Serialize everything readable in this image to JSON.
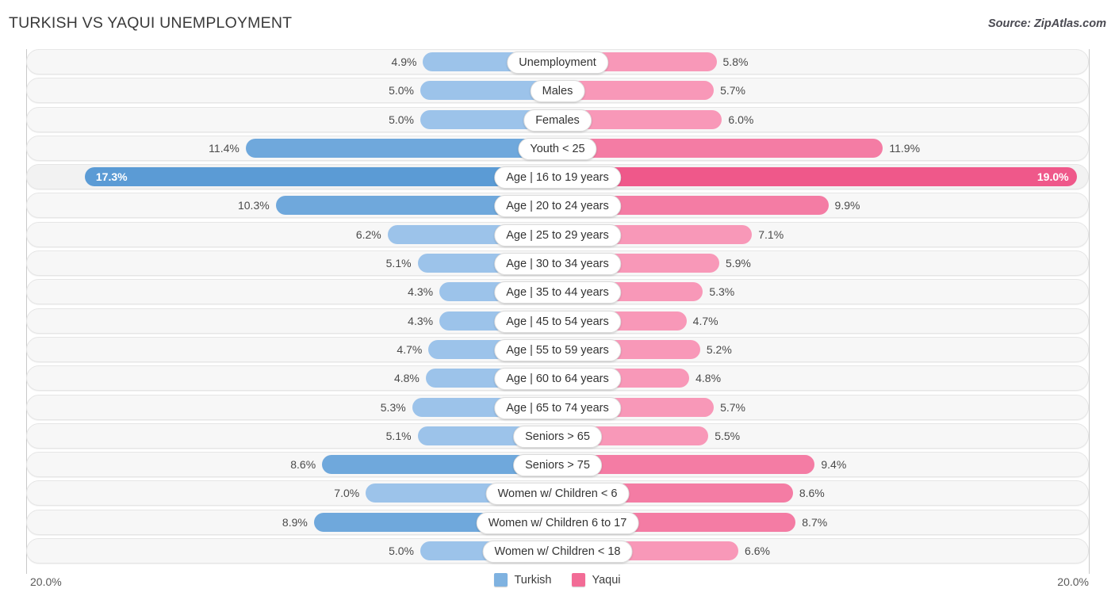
{
  "header": {
    "title": "TURKISH VS YAQUI UNEMPLOYMENT",
    "source": "Source: ZipAtlas.com"
  },
  "axis": {
    "left_label": "20.0%",
    "right_label": "20.0%",
    "max": 20.0
  },
  "legend": {
    "items": [
      {
        "label": "Turkish",
        "color": "#7FB2E0"
      },
      {
        "label": "Yaqui",
        "color": "#F26C96"
      }
    ]
  },
  "colors": {
    "turkish_normal": "#9CC3EA",
    "turkish_strong": "#6FA8DC",
    "turkish_highlight": "#5B9BD5",
    "yaqui_normal": "#F898B8",
    "yaqui_strong": "#F47CA4",
    "yaqui_highlight": "#EF588A"
  },
  "chart_data": {
    "type": "bar",
    "subtype": "diverging-bidirectional",
    "title": "TURKISH VS YAQUI UNEMPLOYMENT",
    "xlabel": "",
    "ylabel": "",
    "xlim": [
      20.0,
      20.0
    ],
    "unit": "%",
    "grid": false,
    "legend_position": "bottom-center",
    "series": [
      {
        "name": "Turkish",
        "side": "left",
        "color": "#9CC3EA",
        "values": [
          4.9,
          5.0,
          5.0,
          11.4,
          17.3,
          10.3,
          6.2,
          5.1,
          4.3,
          4.3,
          4.7,
          4.8,
          5.3,
          5.1,
          8.6,
          7.0,
          8.9,
          5.0
        ]
      },
      {
        "name": "Yaqui",
        "side": "right",
        "color": "#F898B8",
        "values": [
          5.8,
          5.7,
          6.0,
          11.9,
          19.0,
          9.9,
          7.1,
          5.9,
          5.3,
          4.7,
          5.2,
          4.8,
          5.7,
          5.5,
          9.4,
          8.6,
          8.7,
          6.6
        ]
      }
    ],
    "categories": [
      "Unemployment",
      "Males",
      "Females",
      "Youth < 25",
      "Age | 16 to 19 years",
      "Age | 20 to 24 years",
      "Age | 25 to 29 years",
      "Age | 30 to 34 years",
      "Age | 35 to 44 years",
      "Age | 45 to 54 years",
      "Age | 55 to 59 years",
      "Age | 60 to 64 years",
      "Age | 65 to 74 years",
      "Seniors > 65",
      "Seniors > 75",
      "Women w/ Children < 6",
      "Women w/ Children 6 to 17",
      "Women w/ Children < 18"
    ]
  },
  "rows": [
    {
      "label": "Unemployment",
      "left": 4.9,
      "left_text": "4.9%",
      "right": 5.8,
      "right_text": "5.8%",
      "highlight": false
    },
    {
      "label": "Males",
      "left": 5.0,
      "left_text": "5.0%",
      "right": 5.7,
      "right_text": "5.7%",
      "highlight": false
    },
    {
      "label": "Females",
      "left": 5.0,
      "left_text": "5.0%",
      "right": 6.0,
      "right_text": "6.0%",
      "highlight": false
    },
    {
      "label": "Youth < 25",
      "left": 11.4,
      "left_text": "11.4%",
      "right": 11.9,
      "right_text": "11.9%",
      "highlight": false
    },
    {
      "label": "Age | 16 to 19 years",
      "left": 17.3,
      "left_text": "17.3%",
      "right": 19.0,
      "right_text": "19.0%",
      "highlight": true
    },
    {
      "label": "Age | 20 to 24 years",
      "left": 10.3,
      "left_text": "10.3%",
      "right": 9.9,
      "right_text": "9.9%",
      "highlight": false
    },
    {
      "label": "Age | 25 to 29 years",
      "left": 6.2,
      "left_text": "6.2%",
      "right": 7.1,
      "right_text": "7.1%",
      "highlight": false
    },
    {
      "label": "Age | 30 to 34 years",
      "left": 5.1,
      "left_text": "5.1%",
      "right": 5.9,
      "right_text": "5.9%",
      "highlight": false
    },
    {
      "label": "Age | 35 to 44 years",
      "left": 4.3,
      "left_text": "4.3%",
      "right": 5.3,
      "right_text": "5.3%",
      "highlight": false
    },
    {
      "label": "Age | 45 to 54 years",
      "left": 4.3,
      "left_text": "4.3%",
      "right": 4.7,
      "right_text": "4.7%",
      "highlight": false
    },
    {
      "label": "Age | 55 to 59 years",
      "left": 4.7,
      "left_text": "4.7%",
      "right": 5.2,
      "right_text": "5.2%",
      "highlight": false
    },
    {
      "label": "Age | 60 to 64 years",
      "left": 4.8,
      "left_text": "4.8%",
      "right": 4.8,
      "right_text": "4.8%",
      "highlight": false
    },
    {
      "label": "Age | 65 to 74 years",
      "left": 5.3,
      "left_text": "5.3%",
      "right": 5.7,
      "right_text": "5.7%",
      "highlight": false
    },
    {
      "label": "Seniors > 65",
      "left": 5.1,
      "left_text": "5.1%",
      "right": 5.5,
      "right_text": "5.5%",
      "highlight": false
    },
    {
      "label": "Seniors > 75",
      "left": 8.6,
      "left_text": "8.6%",
      "right": 9.4,
      "right_text": "9.4%",
      "highlight": false
    },
    {
      "label": "Women w/ Children < 6",
      "left": 7.0,
      "left_text": "7.0%",
      "right": 8.6,
      "right_text": "8.6%",
      "highlight": false
    },
    {
      "label": "Women w/ Children 6 to 17",
      "left": 8.9,
      "left_text": "8.9%",
      "right": 8.7,
      "right_text": "8.7%",
      "highlight": false
    },
    {
      "label": "Women w/ Children < 18",
      "left": 5.0,
      "left_text": "5.0%",
      "right": 6.6,
      "right_text": "6.6%",
      "highlight": false
    }
  ]
}
